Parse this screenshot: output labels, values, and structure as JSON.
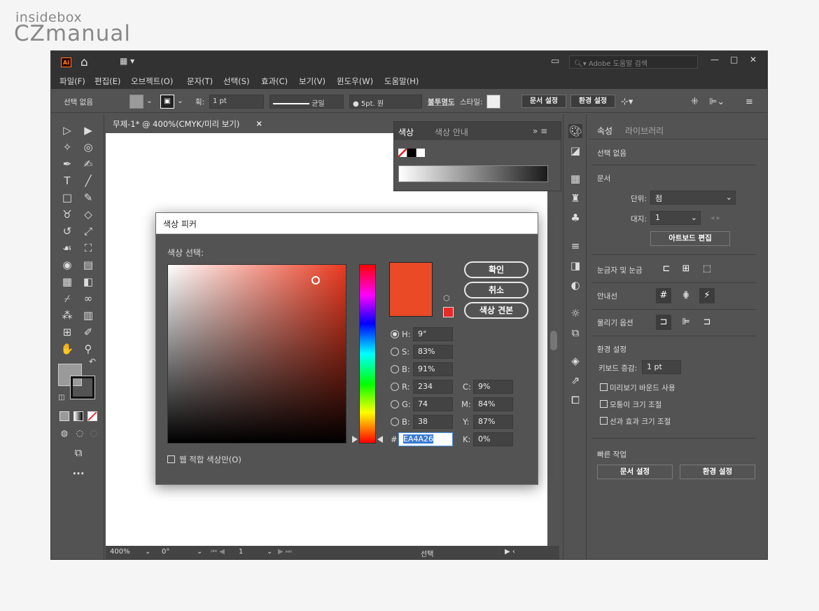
{
  "watermark": {
    "line1": "insidebox",
    "line2": "CZmanual"
  },
  "titlebar": {
    "app_logo": "Ai",
    "search_placeholder": "Adobe 도움말 검색"
  },
  "menu": [
    "파일(F)",
    "편집(E)",
    "오브젝트(O)",
    "문자(T)",
    "선택(S)",
    "효과(C)",
    "보기(V)",
    "윈도우(W)",
    "도움말(H)"
  ],
  "control": {
    "selection": "선택 없음",
    "stroke_label": "획:",
    "stroke_value": "1 pt",
    "stroke_style": "균일",
    "brush": "5pt. 원",
    "opacity_label": "불투명도",
    "style_label": "스타일:",
    "doc_setup": "문서 설정",
    "prefs": "환경 설정"
  },
  "doc_tab": {
    "title": "무제-1* @ 400%(CMYK/미리 보기)",
    "close": "×"
  },
  "swatch_panel": {
    "tab1": "색상",
    "tab2": "색상 안내"
  },
  "status": {
    "zoom": "400%",
    "rotate": "0°",
    "page": "1",
    "tool": "선택"
  },
  "properties": {
    "tab1": "속성",
    "tab2": "라이브러리",
    "none_selected": "선택 없음",
    "document": "문서",
    "units_label": "단위:",
    "units_value": "점",
    "artboard_label": "대지:",
    "artboard_value": "1",
    "edit_artboard": "아트보드 편집",
    "rulers": "눈금자 및 눈금",
    "guides": "안내선",
    "snap": "물리기 옵션",
    "prefs_heading": "환경 설정",
    "key_increment_label": "키보드 증감:",
    "key_increment_value": "1 pt",
    "cb1": "미리보기 바운드 사용",
    "cb2": "모퉁이 크기 조절",
    "cb3": "선과 효과 크기 조절",
    "quick": "빠른 작업",
    "quick_doc": "문서 설정",
    "quick_prefs": "환경 설정"
  },
  "dialog": {
    "title": "색상 피커",
    "select_label": "색상 선택:",
    "ok": "확인",
    "cancel": "취소",
    "swatches": "색상 견본",
    "web_only": "웹 적합 색상만(O)",
    "H_label": "H:",
    "H": "9°",
    "S_label": "S:",
    "S": "83%",
    "Bv_label": "B:",
    "Bv": "91%",
    "R_label": "R:",
    "R": "234",
    "G_label": "G:",
    "G": "74",
    "B_label": "B:",
    "B": "38",
    "C_label": "C:",
    "C": "9%",
    "M_label": "M:",
    "M": "84%",
    "Y_label": "Y:",
    "Y": "87%",
    "K_label": "K:",
    "K": "0%",
    "hash": "#",
    "hex": "EA4A26"
  },
  "colors": {
    "selected": "#ea4a26",
    "hue_base": "#ea3a20"
  }
}
